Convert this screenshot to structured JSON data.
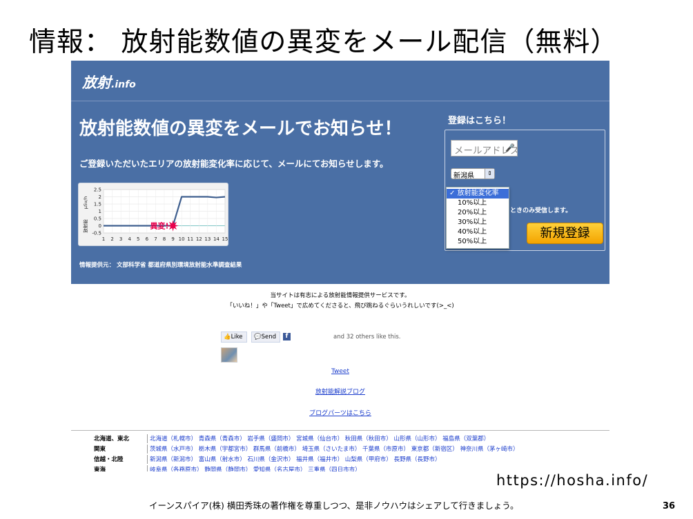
{
  "slide": {
    "title": "情報： 放射能数値の異変をメール配信（無料）",
    "url": "https://hosha.info/",
    "footer": "イーンスパイア(株) 横田秀珠の著作権を尊重しつつ、是非ノウハウはシェアして行きましょう。",
    "page_number": "36"
  },
  "site": {
    "logo_main": "放射",
    "logo_suffix": ".info",
    "headline": "放射能数値の異変をメールでお知らせ！",
    "subline": "ご登録いただいたエリアの放射能変化率に応じて、メールにてお知らせします。",
    "credit": "情報提供元： 文部科学省 都道府県別環境放射能水準調査結果",
    "colors": {
      "hero_bg": "#4a6fa5",
      "button": "#f3a400",
      "link": "#1a3ccc",
      "alert": "#e8004c"
    }
  },
  "registration": {
    "title": "登録はこちら！",
    "email_placeholder": "メールアドレス",
    "mic_icon": "microphone-icon",
    "prefecture_value": "新潟県",
    "note": "ときのみ受信します。",
    "dropdown_options": [
      "放射能変化率",
      "10%以上",
      "20%以上",
      "30%以上",
      "40%以上",
      "50%以上"
    ],
    "selected_mark": "✓",
    "register_button": "新規登録"
  },
  "chart_data": {
    "type": "line",
    "ylabel": "μSv/h",
    "ylabel_side": "放射能",
    "x": [
      1,
      2,
      3,
      4,
      5,
      6,
      7,
      8,
      9,
      10,
      11,
      12,
      13,
      14,
      15
    ],
    "y_ticks": [
      "2.5",
      "2",
      "1.5",
      "1",
      "0.5",
      "0",
      "-0.5"
    ],
    "ylim": [
      -0.5,
      2.5
    ],
    "grid": true,
    "series": [
      {
        "values": [
          0,
          0,
          0,
          0,
          0,
          0,
          0,
          0,
          0,
          2,
          2,
          2,
          2,
          1.95,
          2
        ]
      }
    ],
    "annotation": {
      "label": "異変!",
      "x": 9,
      "y": 0
    }
  },
  "social": {
    "info_line1": "当サイトは有志による放射能情報提供サービスです。",
    "info_line2": "「いいね！」や「Tweet」で広めてくださると、飛び跳ねるぐらいうれしいです(>_<)",
    "like_label": "Like",
    "send_label": "Send",
    "fb_label": "f",
    "others_text": "and 32 others like this.",
    "tweet_link": "Tweet",
    "blog_link": "放射能解説ブログ",
    "parts_link": "ブログパーツはこちら"
  },
  "regions": [
    {
      "name": "北海道、東北",
      "prefs": "北海道（札幌市） 青森県（青森市） 岩手県（盛岡市） 宮城県（仙台市） 秋田県（秋田市） 山形県（山形市） 福島県（双葉郡）"
    },
    {
      "name": "関東",
      "prefs": "茨城県（水戸市） 栃木県（宇都宮市） 群馬県（前橋市） 埼玉県（さいたま市） 千葉県（市原市） 東京都（新宿区） 神奈川県（茅ヶ崎市）"
    },
    {
      "name": "信越・北陸",
      "prefs": "新潟県（新潟市） 富山県（射水市） 石川県（金沢市） 福井県（福井市） 山梨県（甲府市） 長野県（長野市）"
    },
    {
      "name": "東海",
      "prefs": "岐阜県（各務原市） 静岡県（静岡市） 愛知県（名古屋市） 三重県（四日市市）"
    }
  ]
}
